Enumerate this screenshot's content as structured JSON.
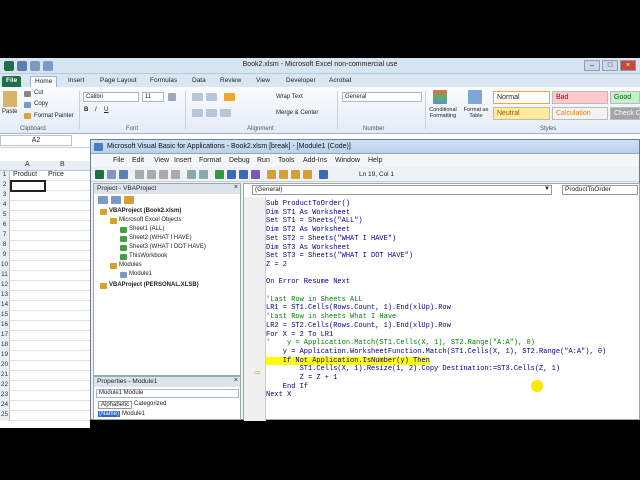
{
  "excel": {
    "title": "Book2.xlsm - Microsoft Excel non-commercial use",
    "tabs": [
      "File",
      "Home",
      "Insert",
      "Page Layout",
      "Formulas",
      "Data",
      "Review",
      "View",
      "Developer",
      "Acrobat"
    ],
    "clipboard": {
      "paste": "Paste",
      "cut": "Cut",
      "copy": "Copy",
      "format_painter": "Format Painter",
      "label": "Clipboard"
    },
    "font": {
      "name": "Calibri",
      "size": "11",
      "label": "Font"
    },
    "alignment": {
      "wrap": "Wrap Text",
      "merge": "Merge & Center",
      "label": "Alignment"
    },
    "number": {
      "format": "General",
      "label": "Number"
    },
    "styles": {
      "conditional": "Conditional Formatting",
      "format_table": "Format as Table",
      "label": "Styles",
      "cells": [
        {
          "name": "Normal",
          "color": "#ffffff",
          "text": "#000000"
        },
        {
          "name": "Bad",
          "color": "#ffc7ce",
          "text": "#9c0006"
        },
        {
          "name": "Good",
          "color": "#c6efce",
          "text": "#006100"
        },
        {
          "name": "Neutral",
          "color": "#ffeb9c",
          "text": "#9c5700"
        },
        {
          "name": "Calculation",
          "color": "#f2f2f2",
          "text": "#fa7d00"
        },
        {
          "name": "Check Cell",
          "color": "#a5a5a5",
          "text": "#ffffff"
        }
      ]
    },
    "namebox": "A2",
    "columns": [
      "A",
      "B"
    ],
    "rows": [
      {
        "num": "1",
        "a": "Product",
        "b": "Price"
      },
      {
        "num": "2",
        "a": "",
        "b": ""
      },
      {
        "num": "3",
        "a": "",
        "b": ""
      },
      {
        "num": "4",
        "a": "",
        "b": ""
      },
      {
        "num": "5",
        "a": "",
        "b": ""
      },
      {
        "num": "6",
        "a": "",
        "b": ""
      },
      {
        "num": "7",
        "a": "",
        "b": ""
      },
      {
        "num": "8",
        "a": "",
        "b": ""
      },
      {
        "num": "9",
        "a": "",
        "b": ""
      },
      {
        "num": "10",
        "a": "",
        "b": ""
      },
      {
        "num": "11",
        "a": "",
        "b": ""
      },
      {
        "num": "12",
        "a": "",
        "b": ""
      },
      {
        "num": "13",
        "a": "",
        "b": ""
      },
      {
        "num": "14",
        "a": "",
        "b": ""
      },
      {
        "num": "15",
        "a": "",
        "b": ""
      },
      {
        "num": "16",
        "a": "",
        "b": ""
      },
      {
        "num": "17",
        "a": "",
        "b": ""
      },
      {
        "num": "18",
        "a": "",
        "b": ""
      },
      {
        "num": "19",
        "a": "",
        "b": ""
      },
      {
        "num": "20",
        "a": "",
        "b": ""
      },
      {
        "num": "21",
        "a": "",
        "b": ""
      },
      {
        "num": "22",
        "a": "",
        "b": ""
      },
      {
        "num": "23",
        "a": "",
        "b": ""
      },
      {
        "num": "24",
        "a": "",
        "b": ""
      },
      {
        "num": "25",
        "a": "",
        "b": ""
      }
    ]
  },
  "vba": {
    "title": "Microsoft Visual Basic for Applications - Book2.xlsm [break] - [Module1 (Code)]",
    "menus": [
      "File",
      "Edit",
      "View",
      "Insert",
      "Format",
      "Debug",
      "Run",
      "Tools",
      "Add-Ins",
      "Window",
      "Help"
    ],
    "position": "Ln 19, Col 1",
    "project_title": "Project - VBAProject",
    "tree": [
      {
        "label": "VBAProject (Book2.xlsm)",
        "level": 0,
        "bold": true
      },
      {
        "label": "Microsoft Excel Objects",
        "level": 1,
        "bold": false
      },
      {
        "label": "Sheet1 (ALL)",
        "level": 2,
        "bold": false
      },
      {
        "label": "Sheet2 (WHAT I HAVE)",
        "level": 2,
        "bold": false
      },
      {
        "label": "Sheet3 (WHAT I DOT HAVE)",
        "level": 2,
        "bold": false
      },
      {
        "label": "ThisWorkbook",
        "level": 2,
        "bold": false
      },
      {
        "label": "Modules",
        "level": 1,
        "bold": false
      },
      {
        "label": "Module1",
        "level": 2,
        "bold": false
      },
      {
        "label": "VBAProject (PERSONAL.XLSB)",
        "level": 0,
        "bold": true
      }
    ],
    "props_title": "Properties - Module1",
    "props_object": "Module1 Module",
    "props_tabs": [
      "Alphabetic",
      "Categorized"
    ],
    "props_row": {
      "key": "(Name)",
      "value": "Module1"
    },
    "object_dropdown": "(General)",
    "proc_dropdown": "ProductToOrder",
    "code": [
      {
        "text": "Sub ProductToOrder()",
        "style": "code"
      },
      {
        "text": "Dim ST1 As Worksheet",
        "style": "code"
      },
      {
        "text": "Set ST1 = Sheets(\"ALL\")",
        "style": "code"
      },
      {
        "text": "Dim ST2 As Worksheet",
        "style": "code"
      },
      {
        "text": "Set ST2 = Sheets(\"WHAT I HAVE\")",
        "style": "code"
      },
      {
        "text": "Dim ST3 As Worksheet",
        "style": "code"
      },
      {
        "text": "Set ST3 = Sheets(\"WHAT I DOT HAVE\")",
        "style": "code"
      },
      {
        "text": "Z = 2",
        "style": "code"
      },
      {
        "text": "",
        "style": "code"
      },
      {
        "text": "On Error Resume Next",
        "style": "code"
      },
      {
        "text": "",
        "style": "code"
      },
      {
        "text": "'Last Row in Sheets ALL",
        "style": "comment"
      },
      {
        "text": "LR1 = ST1.Cells(Rows.Count, 1).End(xlUp).Row",
        "style": "code"
      },
      {
        "text": "'Last Row in sheets What I Have",
        "style": "comment"
      },
      {
        "text": "LR2 = ST2.Cells(Rows.Count, 1).End(xlUp).Row",
        "style": "code"
      },
      {
        "text": "For X = 2 To LR1",
        "style": "code"
      },
      {
        "text": "'    y = Application.Match(ST1.Cells(X, 1), ST2.Range(\"A:A\"), 0)",
        "style": "comment"
      },
      {
        "text": "    y = Application.WorksheetFunction.Match(ST1.Cells(X, 1), ST2.Range(\"A:A\"), 0)",
        "style": "code"
      },
      {
        "text": "    If Not Application.IsNumber(y) Then",
        "style": "highlight"
      },
      {
        "text": "        ST1.Cells(X, 1).Resize(1, 2).Copy Destination:=ST3.Cells(Z, 1)",
        "style": "code"
      },
      {
        "text": "        Z = Z + 1",
        "style": "code"
      },
      {
        "text": "    End If",
        "style": "code"
      },
      {
        "text": "Next X",
        "style": "code"
      }
    ]
  }
}
